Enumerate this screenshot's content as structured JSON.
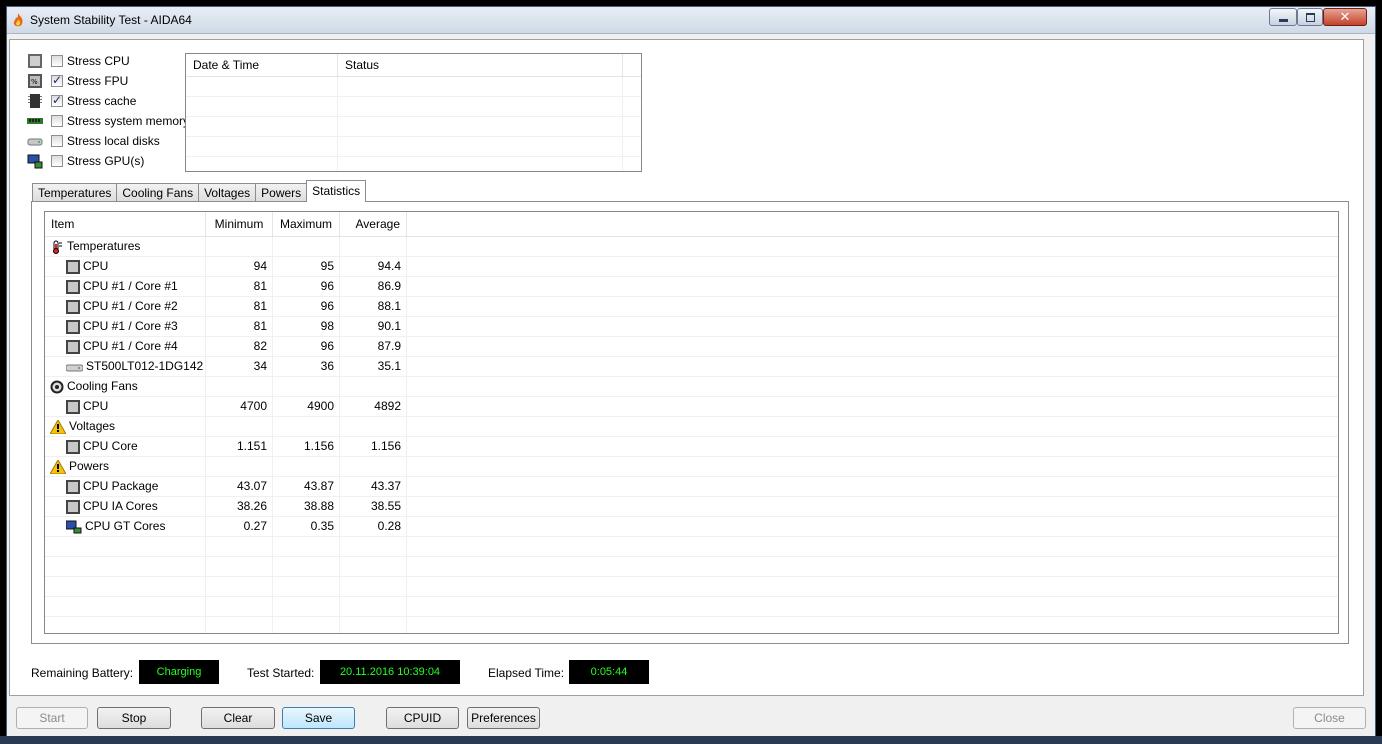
{
  "window": {
    "title": "System Stability Test - AIDA64"
  },
  "stress_options": [
    {
      "label": "Stress CPU",
      "checked": false,
      "icon": "cpu-icon"
    },
    {
      "label": "Stress FPU",
      "checked": true,
      "icon": "fpu-icon"
    },
    {
      "label": "Stress cache",
      "checked": true,
      "icon": "cache-chip-icon"
    },
    {
      "label": "Stress system memory",
      "checked": false,
      "icon": "memory-icon"
    },
    {
      "label": "Stress local disks",
      "checked": false,
      "icon": "disk-icon"
    },
    {
      "label": "Stress GPU(s)",
      "checked": false,
      "icon": "gpu-icon"
    }
  ],
  "log": {
    "columns": [
      "Date & Time",
      "Status"
    ]
  },
  "tabs": [
    {
      "label": "Temperatures",
      "active": false
    },
    {
      "label": "Cooling Fans",
      "active": false
    },
    {
      "label": "Voltages",
      "active": false
    },
    {
      "label": "Powers",
      "active": false
    },
    {
      "label": "Statistics",
      "active": true
    }
  ],
  "stats": {
    "columns": {
      "item": "Item",
      "min": "Minimum",
      "max": "Maximum",
      "avg": "Average"
    },
    "rows": [
      {
        "group": true,
        "label": "Temperatures",
        "icon": "thermometer-icon"
      },
      {
        "label": "CPU",
        "min": "94",
        "max": "95",
        "avg": "94.4",
        "icon": "cpu-icon"
      },
      {
        "label": "CPU #1 / Core #1",
        "min": "81",
        "max": "96",
        "avg": "86.9",
        "icon": "cpu-icon"
      },
      {
        "label": "CPU #1 / Core #2",
        "min": "81",
        "max": "96",
        "avg": "88.1",
        "icon": "cpu-icon"
      },
      {
        "label": "CPU #1 / Core #3",
        "min": "81",
        "max": "98",
        "avg": "90.1",
        "icon": "cpu-icon"
      },
      {
        "label": "CPU #1 / Core #4",
        "min": "82",
        "max": "96",
        "avg": "87.9",
        "icon": "cpu-icon"
      },
      {
        "label": "ST500LT012-1DG142",
        "min": "34",
        "max": "36",
        "avg": "35.1",
        "icon": "disk-icon"
      },
      {
        "group": true,
        "label": "Cooling Fans",
        "icon": "fan-icon"
      },
      {
        "label": "CPU",
        "min": "4700",
        "max": "4900",
        "avg": "4892",
        "icon": "cpu-icon"
      },
      {
        "group": true,
        "label": "Voltages",
        "icon": "warning-icon"
      },
      {
        "label": "CPU Core",
        "min": "1.151",
        "max": "1.156",
        "avg": "1.156",
        "icon": "cpu-icon"
      },
      {
        "group": true,
        "label": "Powers",
        "icon": "warning-icon"
      },
      {
        "label": "CPU Package",
        "min": "43.07",
        "max": "43.87",
        "avg": "43.37",
        "icon": "cpu-icon"
      },
      {
        "label": "CPU IA Cores",
        "min": "38.26",
        "max": "38.88",
        "avg": "38.55",
        "icon": "cpu-icon"
      },
      {
        "label": "CPU GT Cores",
        "min": "0.27",
        "max": "0.35",
        "avg": "0.28",
        "icon": "gpu-icon"
      }
    ]
  },
  "status": {
    "battery_label": "Remaining Battery:",
    "battery_value": "Charging",
    "started_label": "Test Started:",
    "started_value": "20.11.2016 10:39:04",
    "elapsed_label": "Elapsed Time:",
    "elapsed_value": "0:05:44"
  },
  "buttons": {
    "start": "Start",
    "stop": "Stop",
    "clear": "Clear",
    "save": "Save",
    "cpuid": "CPUID",
    "preferences": "Preferences",
    "close": "Close"
  },
  "colors": {
    "status_bg": "#000000",
    "status_fg": "#22ff22",
    "accent": "#3c7fb1"
  }
}
